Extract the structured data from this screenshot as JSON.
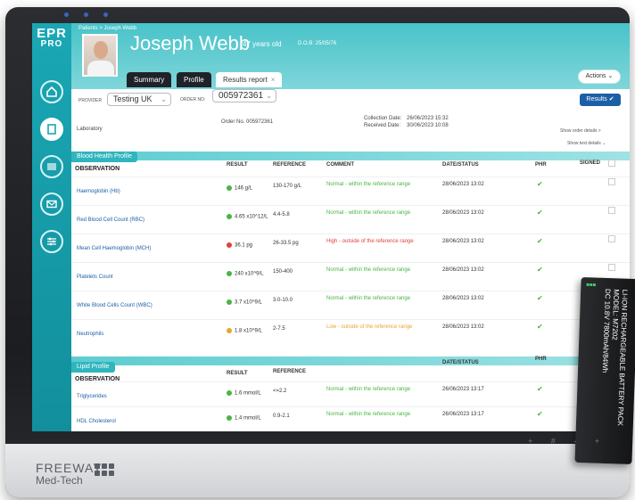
{
  "app": {
    "logo_top": "EPR",
    "logo_bottom": "PRO"
  },
  "header": {
    "breadcrumb": "Patients > Joseph Webb",
    "patient_name": "Joseph Webb",
    "patient_age": "47 years old",
    "dob": "D.O.B: 25/05/76",
    "tabs": [
      {
        "label": "Summary"
      },
      {
        "label": "Profile"
      },
      {
        "label": "Results report"
      }
    ],
    "actions_label": "Actions"
  },
  "meta": {
    "results_label": "Results",
    "provider_label": "PROVIDER",
    "provider_value": "Testing UK",
    "order_no_label": "ORDER NO:",
    "order_no_value": "005972361",
    "laboratory_label": "Laboratory",
    "order_no_text": "Order No. 005972361",
    "collection_date_label": "Collection Date:",
    "collection_date_value": "26/06/2023 15:32",
    "received_date_label": "Received Date:",
    "received_date_value": "30/06/2023 10:08",
    "show_order_details": "Show order details >",
    "show_test_details": "Show test details"
  },
  "blood_health": {
    "title": "Blood Health Profile",
    "columns": {
      "observation": "OBSERVATION",
      "result": "RESULT",
      "reference": "REFERENCE",
      "comment": "COMMENT",
      "date_status": "DATE/STATUS",
      "phr": "PHR",
      "signed": "SIGNED"
    },
    "rows": [
      {
        "observation": "Haemoglobin (Hb)",
        "result": "146 g/L",
        "reference": "130-170 g/L",
        "comment": "Normal - within the reference range",
        "status": "normal",
        "date": "28/06/2023 13:02"
      },
      {
        "observation": "Red Blood Cell Count (RBC)",
        "result": "4.65 x10^12/L",
        "reference": "4.4-5.8",
        "comment": "Normal - within the reference range",
        "status": "normal",
        "date": "28/06/2023 13:02"
      },
      {
        "observation": "Mean Cell Haemoglobin (MCH)",
        "result": "36.1 pg",
        "reference": "26-33.5 pg",
        "comment": "High - outside of the reference range",
        "status": "high",
        "date": "28/06/2023 13:02"
      },
      {
        "observation": "Platelets Count",
        "result": "240 x10^9/L",
        "reference": "150-400",
        "comment": "Normal - within the reference range",
        "status": "normal",
        "date": "28/06/2023 13:02"
      },
      {
        "observation": "White Blood Cells Count (WBC)",
        "result": "3.7 x10^9/L",
        "reference": "3.0-10.0",
        "comment": "Normal - within the reference range",
        "status": "normal",
        "date": "28/06/2023 13:02"
      },
      {
        "observation": "Neutrophils",
        "result": "1.8 x10^9/L",
        "reference": "2-7.5",
        "comment": "Low - outside of the reference range",
        "status": "low",
        "date": "28/06/2023 13:02"
      }
    ]
  },
  "lipid_profile": {
    "title": "Lipid Profile",
    "columns": {
      "observation": "OBSERVATION",
      "result": "RESULT",
      "reference": "REFERENCE",
      "date_status": "DATE/STATUS",
      "phr": "PHR"
    },
    "rows": [
      {
        "observation": "Triglycerides",
        "result": "1.6 mmol/L",
        "reference": "<=2.2",
        "comment": "Normal - within the reference range",
        "status": "normal",
        "date": "26/06/2023 13:17"
      },
      {
        "observation": "HDL Cholesterol",
        "result": "1.4 mmol/L",
        "reference": "0.9-2.1",
        "comment": "Normal - within the reference range",
        "status": "normal",
        "date": "26/06/2023 13:17"
      }
    ]
  },
  "battery": {
    "title": "LI-ION RECHARGEABLE BATTERY PACK",
    "model": "MODEL: M7202",
    "spec": "DC 10.8V 7800mAh/84Wh"
  },
  "brand": {
    "line1": "FREEWAY",
    "line2": "Med-Tech"
  },
  "keys": "+ # - +",
  "colors": {
    "accent": "#2fb5bd",
    "primary_button": "#1d5fa6",
    "normal": "#48b640",
    "high": "#e0413a",
    "low": "#e7a62a"
  },
  "icons": [
    "home-icon",
    "document-icon",
    "barcode-icon",
    "mail-icon",
    "settings-sliders-icon",
    "chevron-down-icon",
    "check-icon"
  ]
}
